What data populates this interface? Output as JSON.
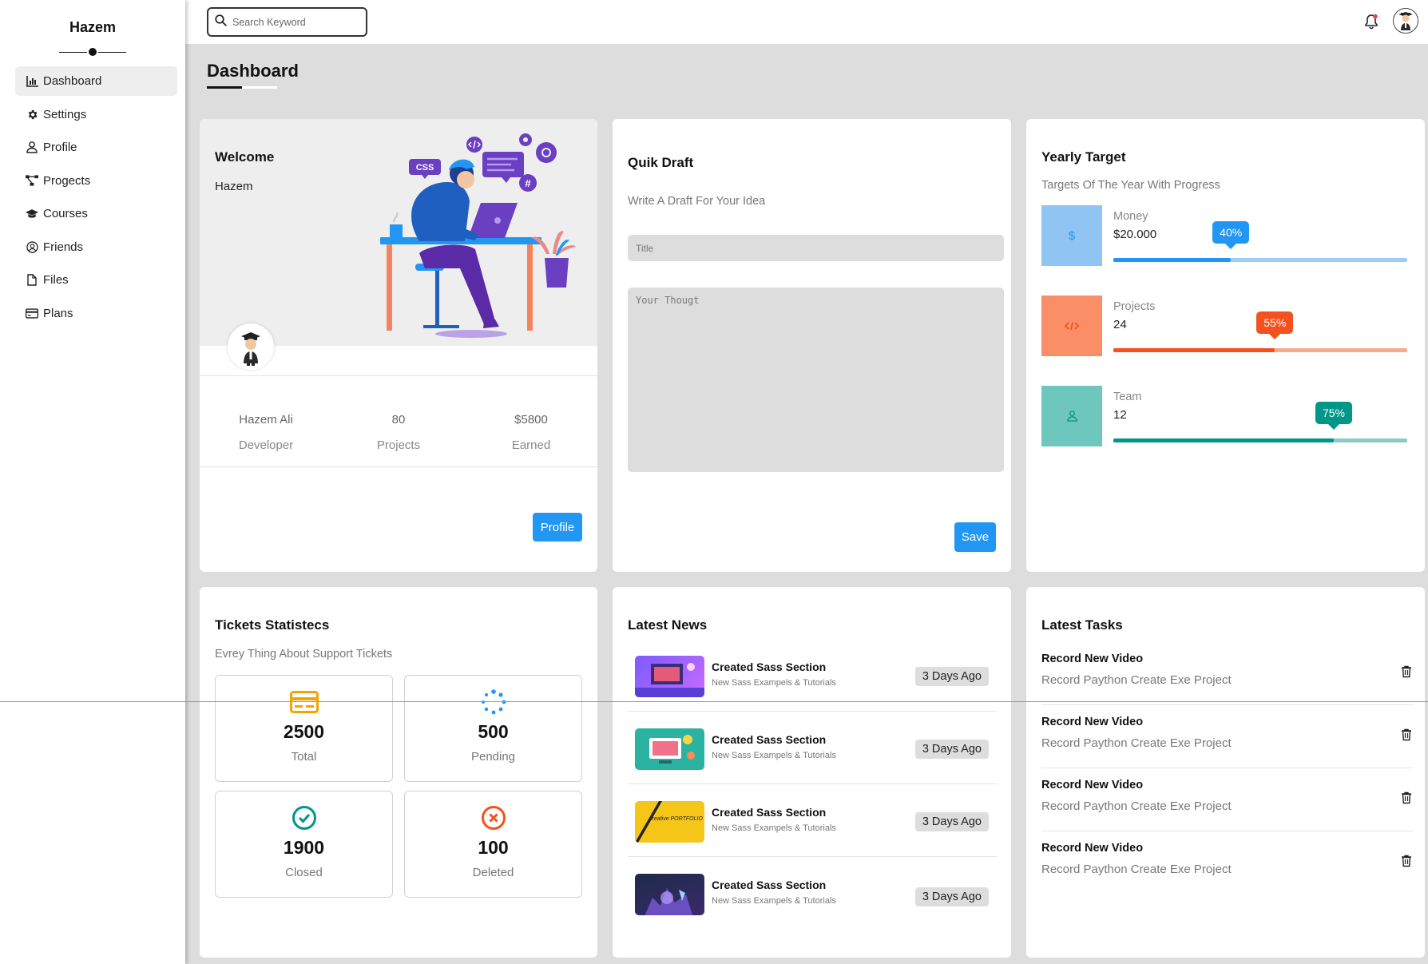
{
  "sidebar": {
    "brand": "Hazem",
    "items": [
      {
        "label": "Dashboard",
        "icon": "chart-icon"
      },
      {
        "label": "Settings",
        "icon": "gear-icon"
      },
      {
        "label": "Profile",
        "icon": "user-icon"
      },
      {
        "label": "Progects",
        "icon": "diagram-icon"
      },
      {
        "label": "Courses",
        "icon": "graduation-cap-icon"
      },
      {
        "label": "Friends",
        "icon": "user-circle-icon"
      },
      {
        "label": "Files",
        "icon": "file-icon"
      },
      {
        "label": "Plans",
        "icon": "credit-card-icon"
      }
    ]
  },
  "topbar": {
    "search_placeholder": "Search Keyword"
  },
  "page": {
    "title": "Dashboard"
  },
  "welcome": {
    "heading": "Welcome",
    "name": "Hazem",
    "illustration_badges": [
      "CSS",
      "#"
    ],
    "stats": [
      {
        "value": "Hazem Ali",
        "label": "Developer"
      },
      {
        "value": "80",
        "label": "Projects"
      },
      {
        "value": "$5800",
        "label": "Earned"
      }
    ],
    "button": "Profile"
  },
  "draft": {
    "heading": "Quik Draft",
    "subtitle": "Write A Draft For Your Idea",
    "title_placeholder": "Title",
    "body_placeholder": "Your Thougt",
    "button": "Save"
  },
  "yearly": {
    "heading": "Yearly Target",
    "subtitle": "Targets Of The Year With Progress",
    "targets": [
      {
        "label": "Money",
        "value": "$20.000",
        "percent_label": "40%",
        "progress": 0.4,
        "icon": "dollar-icon",
        "color": "#2196f3",
        "light": "#9ecdf6",
        "box": "#8fc4f3"
      },
      {
        "label": "Projects",
        "value": "24",
        "percent_label": "55%",
        "progress": 0.55,
        "icon": "code-icon",
        "color": "#f4511e",
        "light": "#f9a98e",
        "box": "#f98e67"
      },
      {
        "label": "Team",
        "value": "12",
        "percent_label": "75%",
        "progress": 0.75,
        "icon": "user-icon",
        "color": "#009688",
        "light": "#8ccbc4",
        "box": "#6ec7bc"
      }
    ]
  },
  "tickets": {
    "heading": "Tickets Statistecs",
    "subtitle": "Evrey Thing About Support Tickets",
    "items": [
      {
        "value": "2500",
        "label": "Total",
        "icon": "credit-card-icon",
        "color": "#f4a300"
      },
      {
        "value": "500",
        "label": "Pending",
        "icon": "spinner-icon",
        "color": "#2196f3"
      },
      {
        "value": "1900",
        "label": "Closed",
        "icon": "check-circle-icon",
        "color": "#009688"
      },
      {
        "value": "100",
        "label": "Deleted",
        "icon": "x-circle-icon",
        "color": "#f4511e"
      }
    ]
  },
  "news": {
    "heading": "Latest News",
    "items": [
      {
        "title": "Created Sass Section",
        "subtitle": "New Sass Exampels & Tutorials",
        "time": "3 Days Ago"
      },
      {
        "title": "Created Sass Section",
        "subtitle": "New Sass Exampels & Tutorials",
        "time": "3 Days Ago"
      },
      {
        "title": "Created Sass Section",
        "subtitle": "New Sass Exampels & Tutorials",
        "time": "3 Days Ago",
        "thumb_text": "creative PORTFOLIO"
      },
      {
        "title": "Created Sass Section",
        "subtitle": "New Sass Exampels & Tutorials",
        "time": "3 Days Ago"
      }
    ]
  },
  "tasks": {
    "heading": "Latest Tasks",
    "items": [
      {
        "title": "Record New Video",
        "subtitle": "Record Paython Create Exe Project"
      },
      {
        "title": "Record New Video",
        "subtitle": "Record Paython Create Exe Project"
      },
      {
        "title": "Record New Video",
        "subtitle": "Record Paython Create Exe Project"
      },
      {
        "title": "Record New Video",
        "subtitle": "Record Paython Create Exe Project"
      }
    ]
  }
}
